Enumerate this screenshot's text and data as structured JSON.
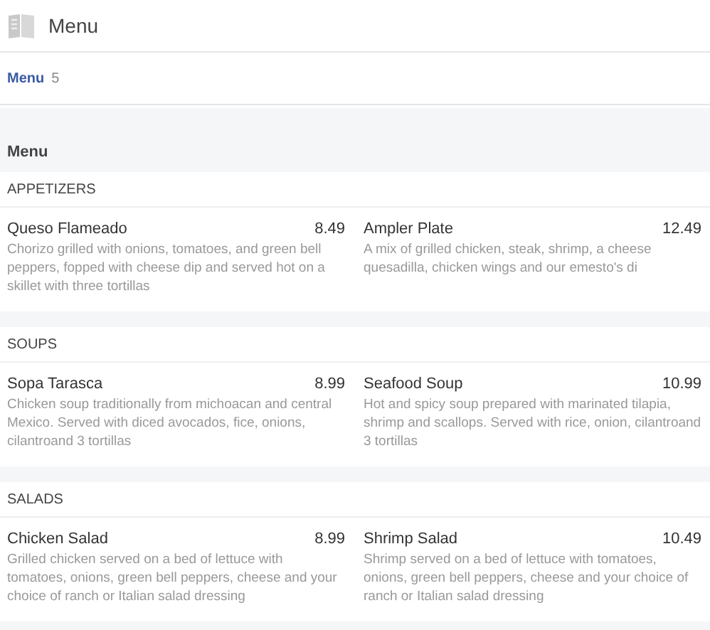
{
  "header": {
    "title": "Menu"
  },
  "tabs": [
    {
      "label": "Menu",
      "count": "5",
      "selected": true
    }
  ],
  "menu_title": "Menu",
  "sections": [
    {
      "name": "APPETIZERS",
      "items": [
        {
          "name": "Queso Flameado",
          "price": "8.49",
          "description": "Chorizo grilled with onions, tomatoes, and green bell peppers, fopped with cheese dip and served hot on a skillet with three tortillas"
        },
        {
          "name": "Ampler Plate",
          "price": "12.49",
          "description": "A mix of grilled chicken, steak, shrimp, a cheese quesadilla, chicken wings and our emesto's di"
        }
      ]
    },
    {
      "name": "SOUPS",
      "items": [
        {
          "name": "Sopa Tarasca",
          "price": "8.99",
          "description": "Chicken soup traditionally from michoacan and central Mexico. Served with diced avocados, fice, onions, cilantroand 3 tortillas"
        },
        {
          "name": "Seafood Soup",
          "price": "10.99",
          "description": "Hot and spicy soup prepared with marinated tilapia, shrimp and scallops. Served with rice, onion, cilantroand 3 tortillas"
        }
      ]
    },
    {
      "name": "SALADS",
      "items": [
        {
          "name": "Chicken Salad",
          "price": "8.99",
          "description": "Grilled chicken served on a bed of lettuce with tomatoes, onions, green bell peppers, cheese and your choice of ranch or Italian salad dressing"
        },
        {
          "name": "Shrimp Salad",
          "price": "10.49",
          "description": "Shrimp served on a bed of lettuce with tomatoes, onions, green bell peppers, cheese and your choice of ranch or Italian salad dressing"
        }
      ]
    }
  ]
}
